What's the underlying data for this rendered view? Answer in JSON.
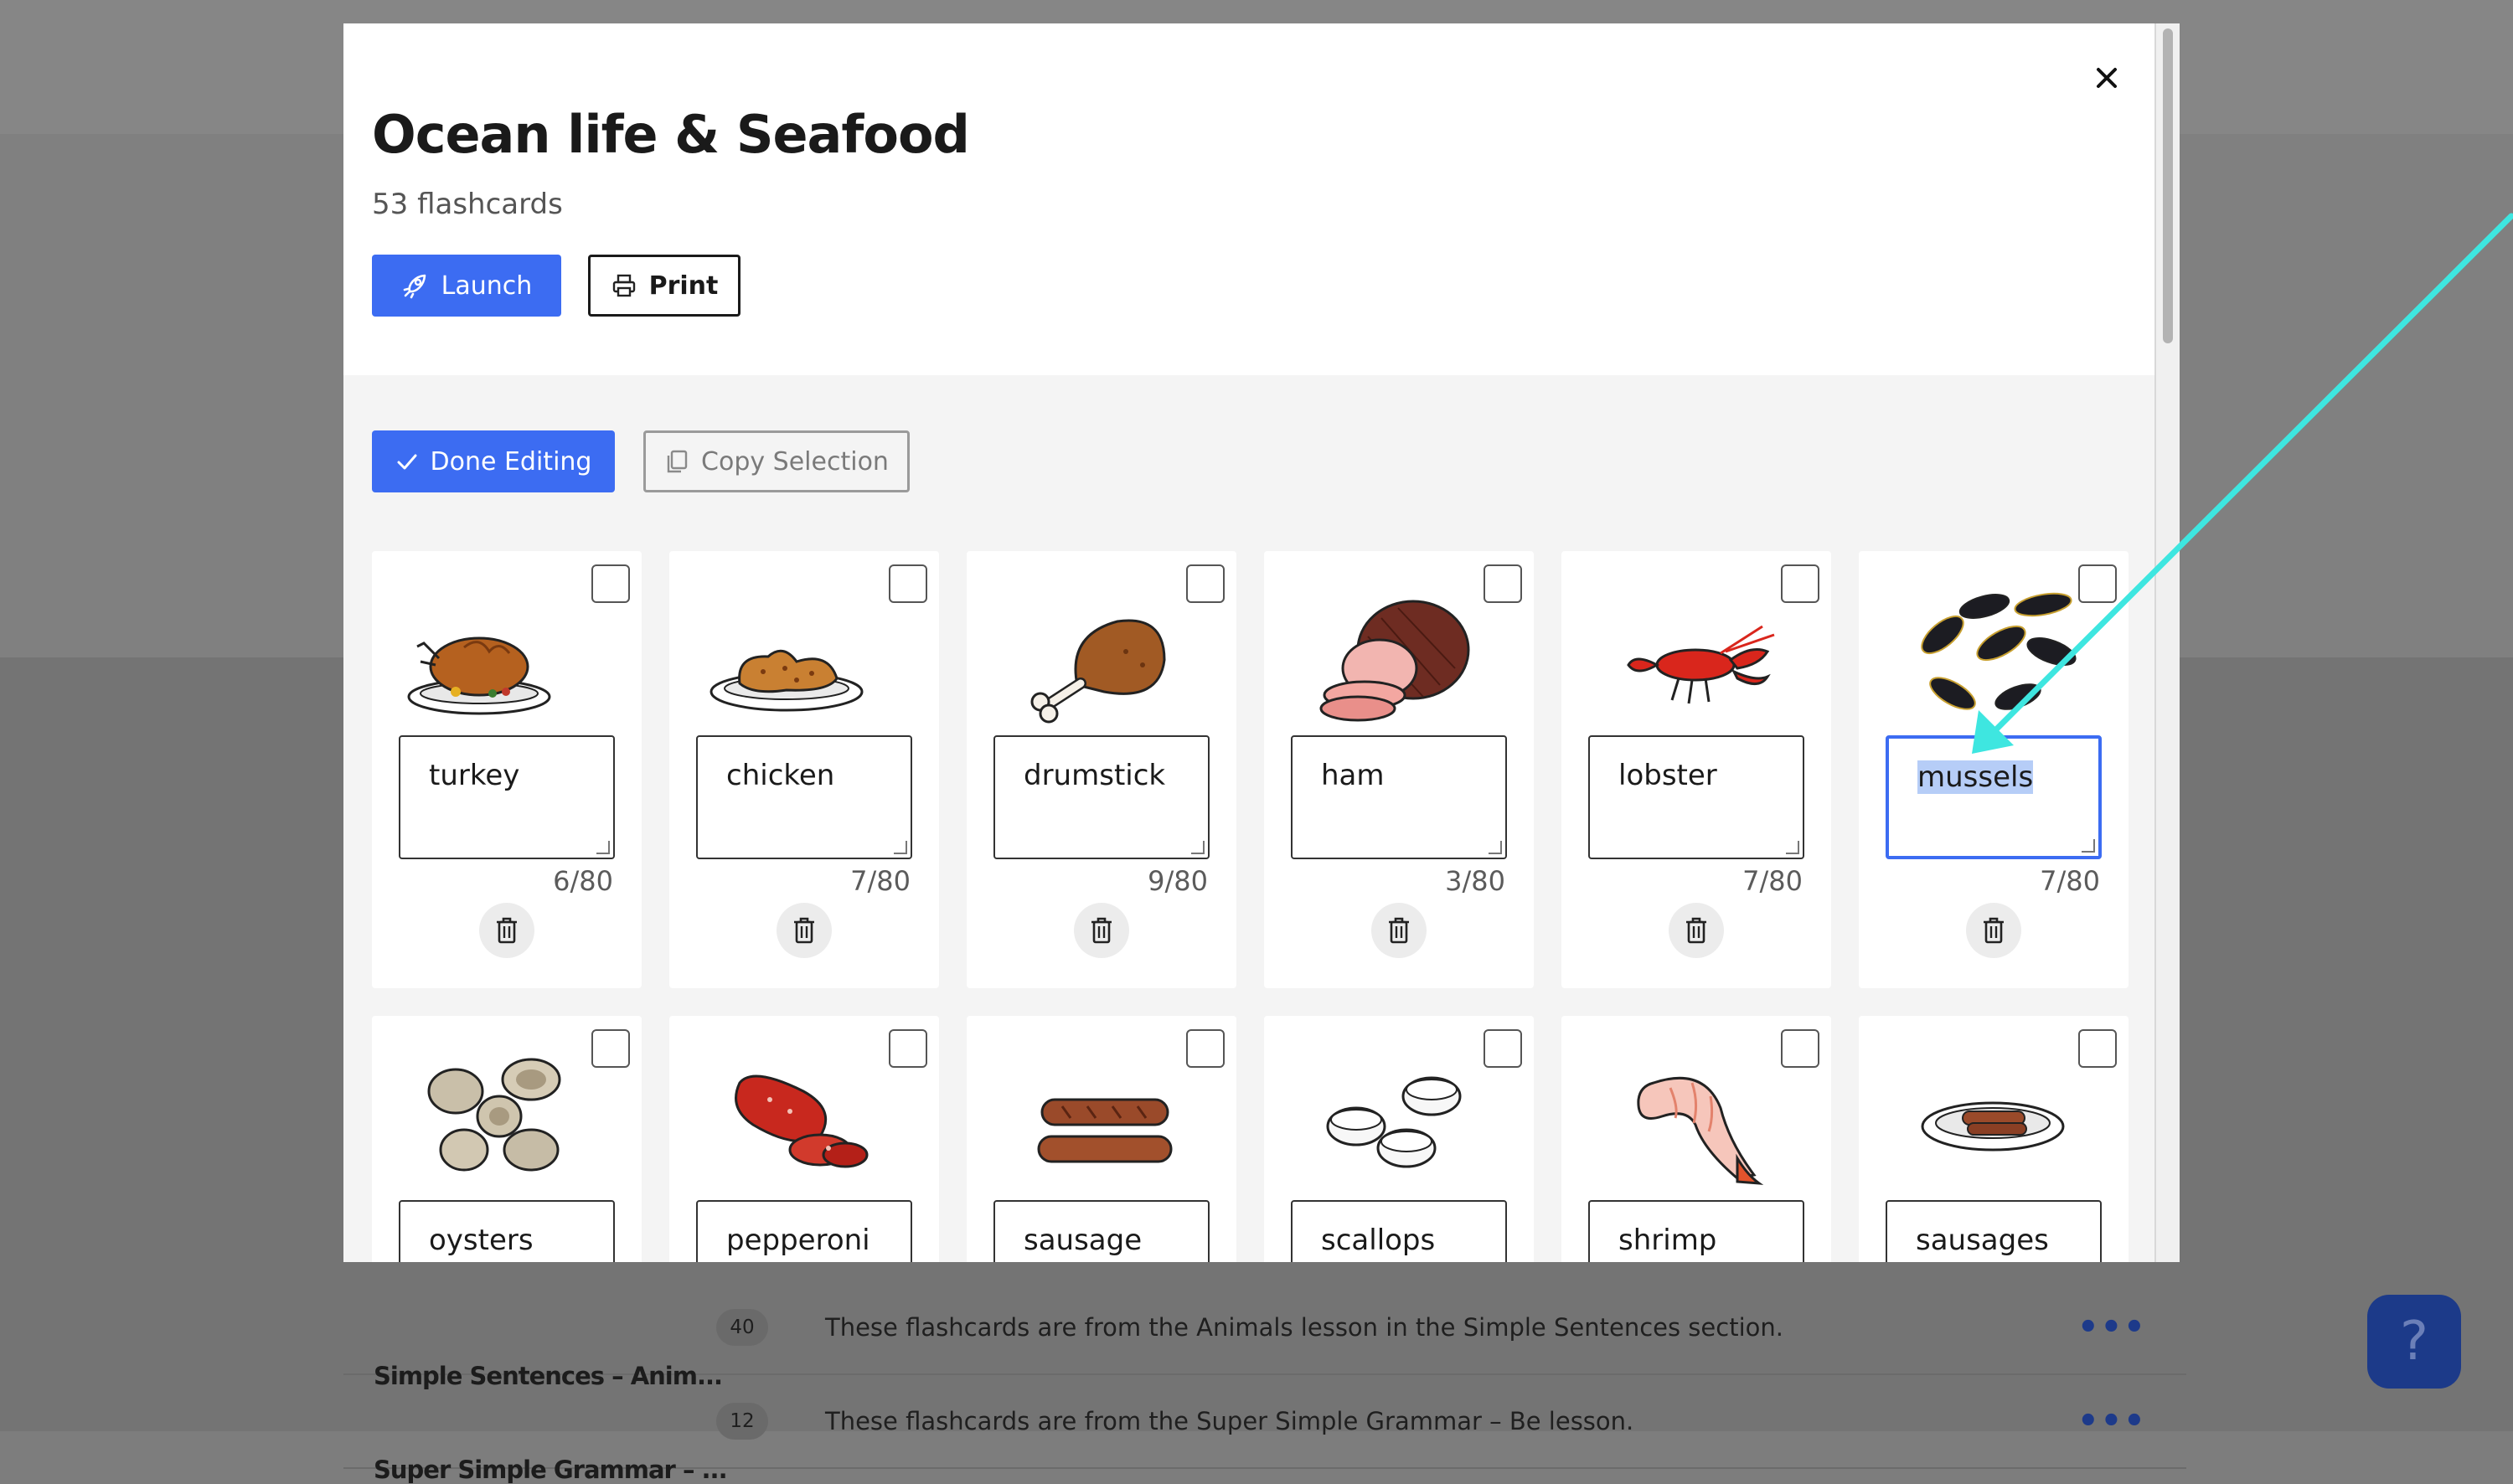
{
  "modal": {
    "title": "Ocean life & Seafood",
    "subtitle": "53 flashcards",
    "launch_label": "Launch",
    "print_label": "Print",
    "done_label": "Done Editing",
    "copy_label": "Copy Selection",
    "close_icon": "close-icon"
  },
  "cards_row1": [
    {
      "label": "turkey",
      "counter": "6/80",
      "icon": "turkey-icon"
    },
    {
      "label": "chicken",
      "counter": "7/80",
      "icon": "chicken-icon"
    },
    {
      "label": "drumstick",
      "counter": "9/80",
      "icon": "drumstick-icon"
    },
    {
      "label": "ham",
      "counter": "3/80",
      "icon": "ham-icon"
    },
    {
      "label": "lobster",
      "counter": "7/80",
      "icon": "lobster-icon"
    },
    {
      "label": "mussels",
      "counter": "7/80",
      "icon": "mussels-icon"
    }
  ],
  "cards_row2": [
    {
      "label": "oysters",
      "icon": "oysters-icon"
    },
    {
      "label": "pepperoni",
      "icon": "pepperoni-icon"
    },
    {
      "label": "sausage",
      "icon": "sausage-icon"
    },
    {
      "label": "scallops",
      "icon": "scallops-icon"
    },
    {
      "label": "shrimp",
      "icon": "shrimp-icon"
    },
    {
      "label": "sausages",
      "icon": "sausages-icon"
    }
  ],
  "background_list": [
    {
      "title": "Simple Sentences – Anim...",
      "count": "40",
      "desc": "These flashcards are from the Animals lesson in the Simple Sentences section."
    },
    {
      "title": "Super Simple Grammar – ...",
      "count": "12",
      "desc": "These flashcards are from the Super Simple Grammar – Be lesson."
    }
  ],
  "colors": {
    "accent": "#3c6cf2",
    "arrow": "#3ee6e0",
    "overlay": "#7d7d7d"
  }
}
